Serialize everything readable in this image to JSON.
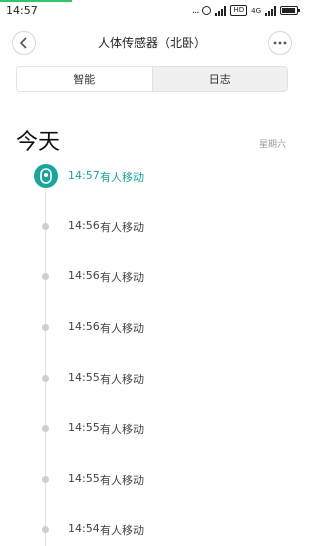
{
  "status_bar": {
    "time": "14:57",
    "indicator": "...",
    "hd_label": "HD",
    "network_label": "4G"
  },
  "nav": {
    "title": "人体传感器（北卧）"
  },
  "tabs": [
    {
      "label": "智能"
    },
    {
      "label": "日志"
    }
  ],
  "header": {
    "day": "今天",
    "weekday": "星期六"
  },
  "log": [
    {
      "time": "14:57",
      "event": "有人移动"
    },
    {
      "time": "14:56",
      "event": "有人移动"
    },
    {
      "time": "14:56",
      "event": "有人移动"
    },
    {
      "time": "14:56",
      "event": "有人移动"
    },
    {
      "time": "14:55",
      "event": "有人移动"
    },
    {
      "time": "14:55",
      "event": "有人移动"
    },
    {
      "time": "14:55",
      "event": "有人移动"
    },
    {
      "time": "14:54",
      "event": "有人移动"
    }
  ],
  "icons": {
    "back": "chevron-left-icon",
    "more": "more-dots-icon",
    "sensor": "motion-sensor-icon",
    "alarm": "alarm-clock-icon",
    "signal": "signal-icon",
    "battery": "battery-icon"
  },
  "colors": {
    "accent": "#1aa59b",
    "status_accent": "#33c46a"
  }
}
